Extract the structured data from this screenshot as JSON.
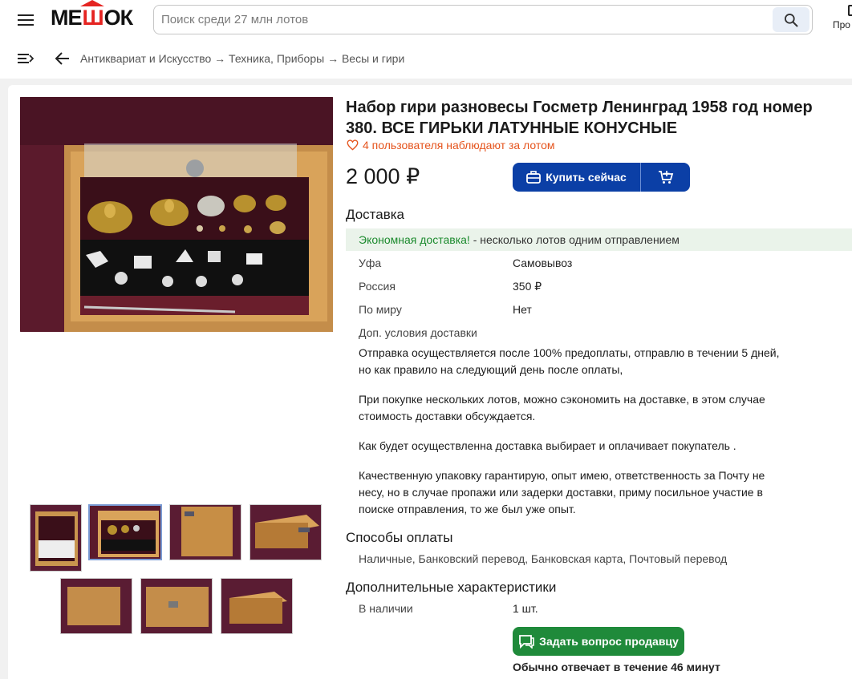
{
  "header": {
    "logo": "МЕШОК",
    "search_placeholder": "Поиск среди 27 млн лотов",
    "profile_label": "Про"
  },
  "breadcrumbs": {
    "items": [
      "Антиквариат и Искусство",
      "Техника, Приборы",
      "Весы и гири"
    ],
    "separator": "→"
  },
  "lot": {
    "title": "Набор гири разновесы Госметр Ленинград 1958 год номер 380. ВСЕ ГИРЬКИ ЛАТУННЫЕ КОНУСНЫЕ",
    "watchers": "4 пользователя наблюдают за лотом",
    "price": "2 000 ₽",
    "buy_now_label": "Купить сейчас"
  },
  "delivery": {
    "heading": "Доставка",
    "eco_highlight": "Экономная доставка!",
    "eco_rest": " - несколько лотов одним отправлением",
    "rows": [
      {
        "label": "Уфа",
        "value": "Самовывоз"
      },
      {
        "label": "Россия",
        "value": "350 ₽"
      },
      {
        "label": "По миру",
        "value": "Нет"
      }
    ],
    "extra_label": "Доп. условия доставки",
    "paragraphs": [
      "Отправка осуществляется после 100% предоплаты, отправлю в течении 5 дней, но как правило на следующий день после оплаты,",
      "При покупке нескольких лотов, можно сэкономить на доставке, в этом случае стоимость доставки обсуждается.",
      "Как будет осуществленна доставка выбирает и оплачивает покупатель .",
      "Качественную упаковку гарантирую, опыт имею, ответственность за Почту не несу, но в случае пропажи или задерки доставки, приму посильное участие в поиске отправления, то же был уже опыт."
    ]
  },
  "payment": {
    "heading": "Способы оплаты",
    "methods": "Наличные, Банковский перевод, Банковская карта, Почтовый перевод"
  },
  "specs": {
    "heading": "Дополнительные характеристики",
    "rows": [
      {
        "label": "В наличии",
        "value": "1 шт."
      }
    ]
  },
  "seller": {
    "ask_label": "Задать вопрос продавцу",
    "reply_time": "Обычно отвечает в течение 46 минут"
  },
  "colors": {
    "accent_blue": "#0b3fa6",
    "accent_green": "#1f8a3a",
    "watch_orange": "#e5541d",
    "eco_green": "#1b8a2d"
  },
  "thumbnails": 7,
  "selected_thumbnail": 2
}
